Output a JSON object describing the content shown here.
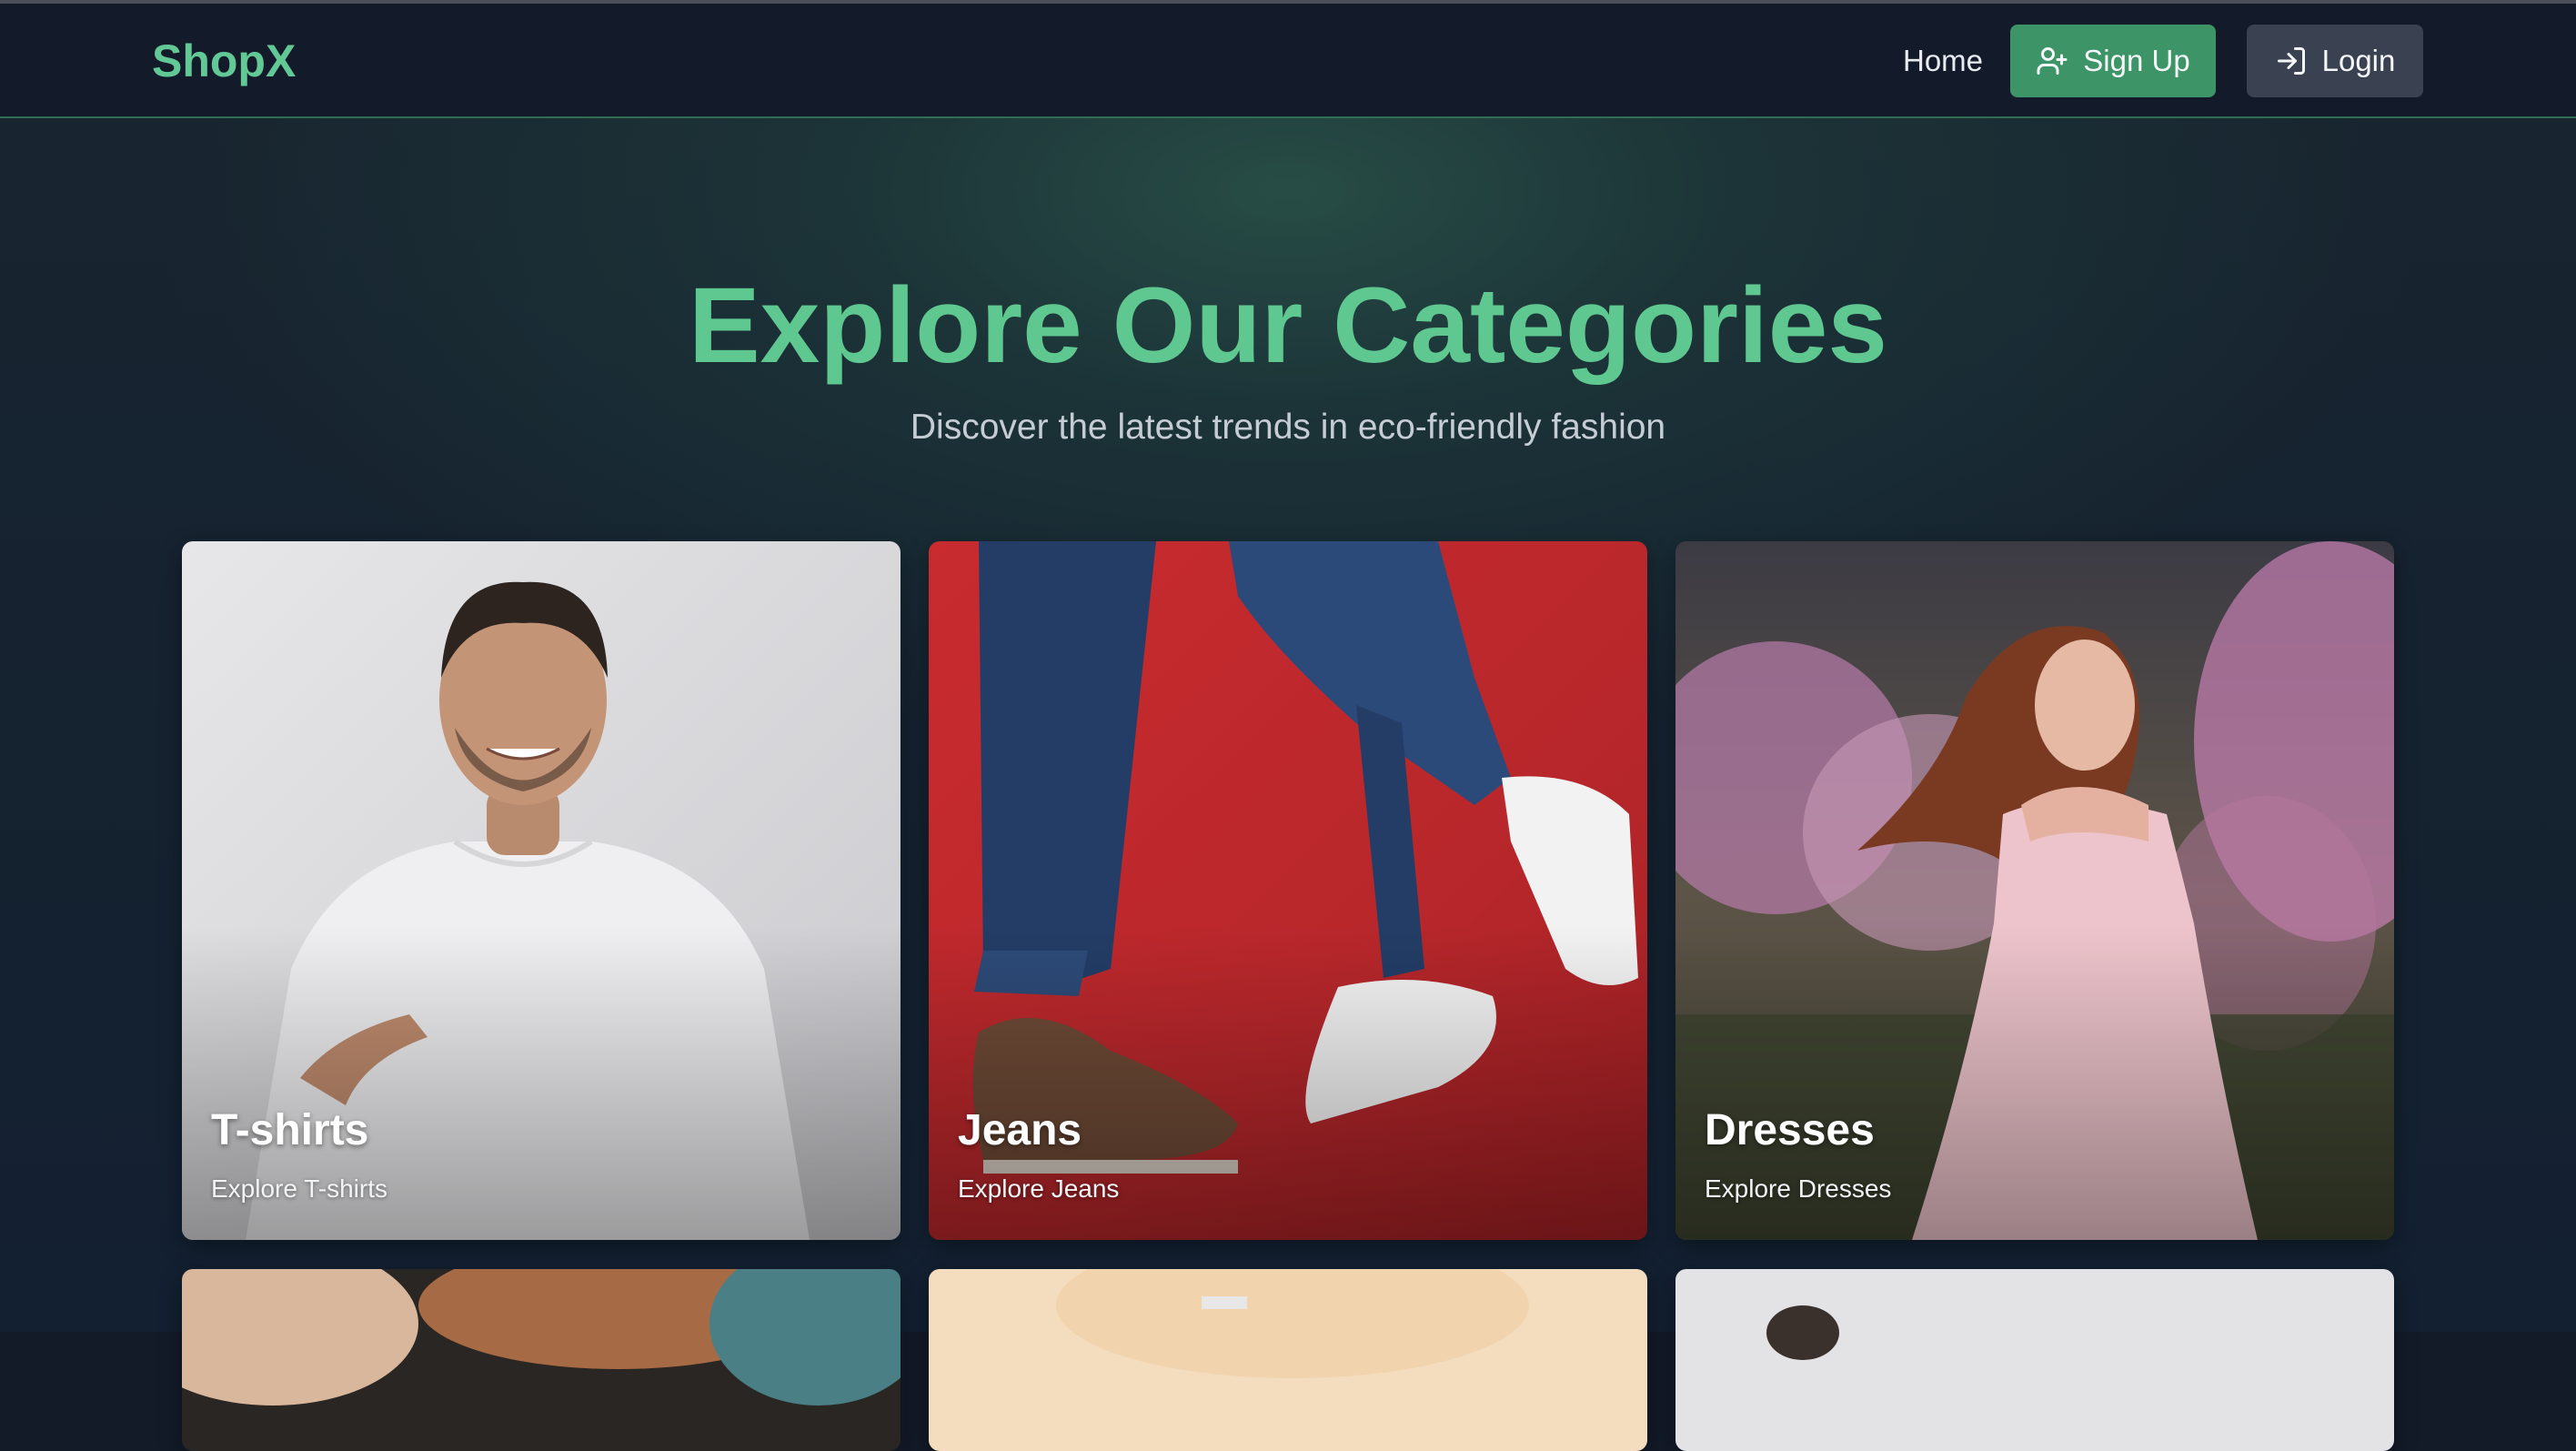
{
  "navbar": {
    "brand": "ShopX",
    "home_label": "Home",
    "signup_label": "Sign Up",
    "login_label": "Login",
    "signup_icon": "user-plus-icon",
    "login_icon": "log-in-icon"
  },
  "hero": {
    "title": "Explore Our Categories",
    "subtitle": "Discover the latest trends in eco-friendly fashion"
  },
  "categories": [
    {
      "title": "T-shirts",
      "subtitle": "Explore T-shirts",
      "image": "man-in-white-tshirt-photo"
    },
    {
      "title": "Jeans",
      "subtitle": "Explore Jeans",
      "image": "legs-in-jeans-red-background-photo"
    },
    {
      "title": "Dresses",
      "subtitle": "Explore Dresses",
      "image": "woman-in-pink-dress-blossoms-photo"
    },
    {
      "title": "",
      "subtitle": "",
      "image": "partial-photo-skin-tones"
    },
    {
      "title": "",
      "subtitle": "",
      "image": "partial-photo-cream-tones"
    },
    {
      "title": "",
      "subtitle": "",
      "image": "partial-photo-light-grey"
    }
  ],
  "colors": {
    "accent": "#5fc890",
    "signup_bg": "#3c9467",
    "login_bg": "#3a4150",
    "page_bg": "#131b28"
  }
}
